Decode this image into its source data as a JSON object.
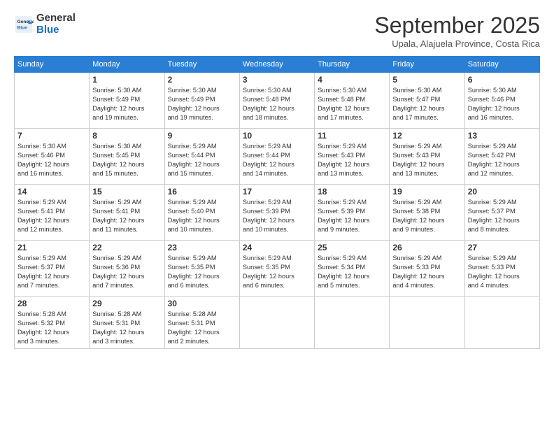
{
  "logo": {
    "general": "General",
    "blue": "Blue"
  },
  "title": "September 2025",
  "location": "Upala, Alajuela Province, Costa Rica",
  "weekdays": [
    "Sunday",
    "Monday",
    "Tuesday",
    "Wednesday",
    "Thursday",
    "Friday",
    "Saturday"
  ],
  "weeks": [
    [
      {
        "day": "",
        "info": ""
      },
      {
        "day": "1",
        "info": "Sunrise: 5:30 AM\nSunset: 5:49 PM\nDaylight: 12 hours\nand 19 minutes."
      },
      {
        "day": "2",
        "info": "Sunrise: 5:30 AM\nSunset: 5:49 PM\nDaylight: 12 hours\nand 19 minutes."
      },
      {
        "day": "3",
        "info": "Sunrise: 5:30 AM\nSunset: 5:48 PM\nDaylight: 12 hours\nand 18 minutes."
      },
      {
        "day": "4",
        "info": "Sunrise: 5:30 AM\nSunset: 5:48 PM\nDaylight: 12 hours\nand 17 minutes."
      },
      {
        "day": "5",
        "info": "Sunrise: 5:30 AM\nSunset: 5:47 PM\nDaylight: 12 hours\nand 17 minutes."
      },
      {
        "day": "6",
        "info": "Sunrise: 5:30 AM\nSunset: 5:46 PM\nDaylight: 12 hours\nand 16 minutes."
      }
    ],
    [
      {
        "day": "7",
        "info": "Sunrise: 5:30 AM\nSunset: 5:46 PM\nDaylight: 12 hours\nand 16 minutes."
      },
      {
        "day": "8",
        "info": "Sunrise: 5:30 AM\nSunset: 5:45 PM\nDaylight: 12 hours\nand 15 minutes."
      },
      {
        "day": "9",
        "info": "Sunrise: 5:29 AM\nSunset: 5:44 PM\nDaylight: 12 hours\nand 15 minutes."
      },
      {
        "day": "10",
        "info": "Sunrise: 5:29 AM\nSunset: 5:44 PM\nDaylight: 12 hours\nand 14 minutes."
      },
      {
        "day": "11",
        "info": "Sunrise: 5:29 AM\nSunset: 5:43 PM\nDaylight: 12 hours\nand 13 minutes."
      },
      {
        "day": "12",
        "info": "Sunrise: 5:29 AM\nSunset: 5:43 PM\nDaylight: 12 hours\nand 13 minutes."
      },
      {
        "day": "13",
        "info": "Sunrise: 5:29 AM\nSunset: 5:42 PM\nDaylight: 12 hours\nand 12 minutes."
      }
    ],
    [
      {
        "day": "14",
        "info": "Sunrise: 5:29 AM\nSunset: 5:41 PM\nDaylight: 12 hours\nand 12 minutes."
      },
      {
        "day": "15",
        "info": "Sunrise: 5:29 AM\nSunset: 5:41 PM\nDaylight: 12 hours\nand 11 minutes."
      },
      {
        "day": "16",
        "info": "Sunrise: 5:29 AM\nSunset: 5:40 PM\nDaylight: 12 hours\nand 10 minutes."
      },
      {
        "day": "17",
        "info": "Sunrise: 5:29 AM\nSunset: 5:39 PM\nDaylight: 12 hours\nand 10 minutes."
      },
      {
        "day": "18",
        "info": "Sunrise: 5:29 AM\nSunset: 5:39 PM\nDaylight: 12 hours\nand 9 minutes."
      },
      {
        "day": "19",
        "info": "Sunrise: 5:29 AM\nSunset: 5:38 PM\nDaylight: 12 hours\nand 9 minutes."
      },
      {
        "day": "20",
        "info": "Sunrise: 5:29 AM\nSunset: 5:37 PM\nDaylight: 12 hours\nand 8 minutes."
      }
    ],
    [
      {
        "day": "21",
        "info": "Sunrise: 5:29 AM\nSunset: 5:37 PM\nDaylight: 12 hours\nand 7 minutes."
      },
      {
        "day": "22",
        "info": "Sunrise: 5:29 AM\nSunset: 5:36 PM\nDaylight: 12 hours\nand 7 minutes."
      },
      {
        "day": "23",
        "info": "Sunrise: 5:29 AM\nSunset: 5:35 PM\nDaylight: 12 hours\nand 6 minutes."
      },
      {
        "day": "24",
        "info": "Sunrise: 5:29 AM\nSunset: 5:35 PM\nDaylight: 12 hours\nand 6 minutes."
      },
      {
        "day": "25",
        "info": "Sunrise: 5:29 AM\nSunset: 5:34 PM\nDaylight: 12 hours\nand 5 minutes."
      },
      {
        "day": "26",
        "info": "Sunrise: 5:29 AM\nSunset: 5:33 PM\nDaylight: 12 hours\nand 4 minutes."
      },
      {
        "day": "27",
        "info": "Sunrise: 5:29 AM\nSunset: 5:33 PM\nDaylight: 12 hours\nand 4 minutes."
      }
    ],
    [
      {
        "day": "28",
        "info": "Sunrise: 5:28 AM\nSunset: 5:32 PM\nDaylight: 12 hours\nand 3 minutes."
      },
      {
        "day": "29",
        "info": "Sunrise: 5:28 AM\nSunset: 5:31 PM\nDaylight: 12 hours\nand 3 minutes."
      },
      {
        "day": "30",
        "info": "Sunrise: 5:28 AM\nSunset: 5:31 PM\nDaylight: 12 hours\nand 2 minutes."
      },
      {
        "day": "",
        "info": ""
      },
      {
        "day": "",
        "info": ""
      },
      {
        "day": "",
        "info": ""
      },
      {
        "day": "",
        "info": ""
      }
    ]
  ]
}
